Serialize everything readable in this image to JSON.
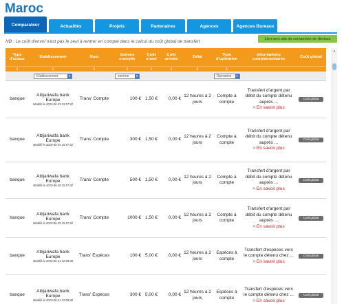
{
  "page": {
    "title": "Maroc"
  },
  "tabs": [
    {
      "label": "Comparateur",
      "active": true
    },
    {
      "label": "Actualités",
      "active": false
    },
    {
      "label": "Projets",
      "active": false
    },
    {
      "label": "Partenaires",
      "active": false
    },
    {
      "label": "Agences",
      "active": false
    },
    {
      "label": "Agences Bureaux",
      "active": false
    }
  ],
  "conversion_link": "Lien vers site de conversion de devises",
  "note": "NB : Le coût d'envoi n'est pas le seul à rentrer en compte dans le calcul du coût global de transfert",
  "table": {
    "headers": [
      "Type d'acteur",
      "Etablissement",
      "Nom",
      "Somme envoyée",
      "Coût envoi",
      "Coût arrivée",
      "Délai",
      "Type d'opération",
      "Informations complémentaires",
      "Coût global"
    ],
    "sort_arrow": "⇕",
    "filters": {
      "etablissement": "Etablissement",
      "somme": "somme",
      "operation": "Opération"
    },
    "button_label": "Coût global",
    "rows": [
      {
        "type": "banque",
        "etab": "Attijariwafa bank Europe",
        "modified": "Modifié le 2010-06-29 15:57:42",
        "nom": "Trans' Compte",
        "somme": "100 €",
        "envoi": "1,50 €",
        "arrivee": "0,00 €",
        "delai": "12 heures à 2 jours",
        "operation": "Compte à compte",
        "info": "Transfert d'argent par débit du compte détenu auprès ...",
        "more": "> En savoir plus"
      },
      {
        "type": "banque",
        "etab": "Attijariwafa bank Europe",
        "modified": "Modifié le 2010-06-29 15:57:42",
        "nom": "Trans' Compte",
        "somme": "300 €",
        "envoi": "1,50 €",
        "arrivee": "0,00 €",
        "delai": "12 heures à 2 jours",
        "operation": "Compte à compte",
        "info": "Transfert d'argent par débit du compte détenu auprès ...",
        "more": "> En savoir plus"
      },
      {
        "type": "banque",
        "etab": "Attijariwafa bank Europe",
        "modified": "Modifié le 2010-06-29 15:57:42",
        "nom": "Trans' Compte",
        "somme": "500 €",
        "envoi": "1,50 €",
        "arrivee": "0,00 €",
        "delai": "12 heures à 2 jours",
        "operation": "Compte à compte",
        "info": "Transfert d'argent par débit du compte détenu auprès ...",
        "more": "> En savoir plus"
      },
      {
        "type": "banque",
        "etab": "Attijariwafa bank Europe",
        "modified": "Modifié le 2010-06-29 15:57:42",
        "nom": "Trans' Compte",
        "somme": "1000 €",
        "envoi": "1,50 €",
        "arrivee": "0,00 €",
        "delai": "12 heures à 2 jours",
        "operation": "Compte à compte",
        "info": "Transfert d'argent par débit du compte détenu auprès ...",
        "more": "> En savoir plus"
      },
      {
        "type": "banque",
        "etab": "Attijariwafa bank Europe",
        "modified": "Modifié le 2010-06-24 12:08:45",
        "nom": "Trans' Espèces",
        "somme": "100 €",
        "envoi": "5,00 €",
        "arrivee": "0,00 €",
        "delai": "12 heures à 2 jours",
        "operation": "Espèces à compte",
        "info": "Transfert d'espèces vers le compte détenu chez ...",
        "more": "> En savoir plus"
      },
      {
        "type": "banque",
        "etab": "Attijariwafa bank Europe",
        "modified": "Modifié le 2010-06-24 12:08:45",
        "nom": "Trans' Espèces",
        "somme": "300 €",
        "envoi": "5,00 €",
        "arrivee": "0,00 €",
        "delai": "12 heures à 2 jours",
        "operation": "Espèces à compte",
        "info": "Transfert d'espèces vers le compte détenu chez ...",
        "more": "> En savoir plus"
      }
    ]
  }
}
